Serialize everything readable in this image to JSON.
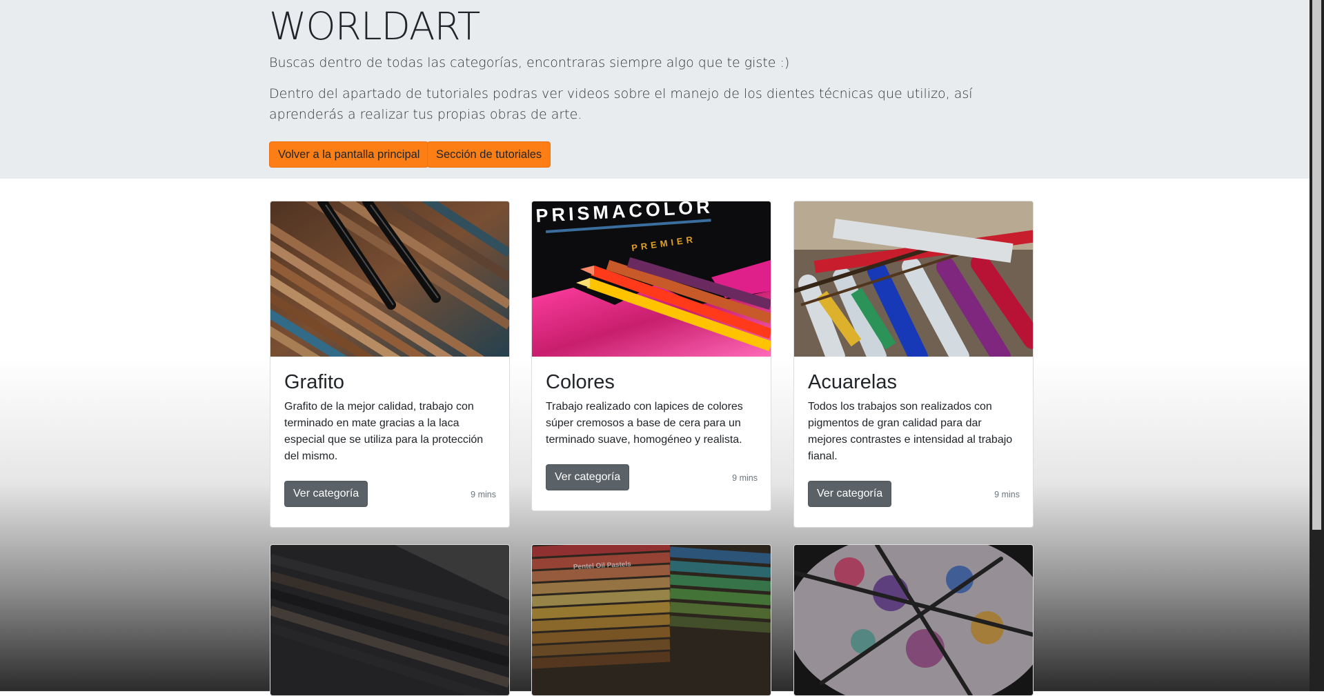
{
  "header": {
    "title": "WORLDART",
    "lead1": "Buscas dentro de todas las categorías, encontraras siempre algo que te giste :)",
    "lead2": "Dentro del apartado de tutoriales podras ver videos sobre el manejo de los dientes técnicas que utilizo, así aprenderás a realizar tus propias obras de arte.",
    "btn_home": "Volver a la pantalla principal",
    "btn_tutorials": "Sección de tutoriales"
  },
  "cards": [
    {
      "title": "Grafito",
      "text": "Grafito de la mejor calidad, trabajo con terminado en mate gracias a la laca especial que se utiliza para la protección del mismo.",
      "button": "Ver categoría",
      "time": "9 mins"
    },
    {
      "title": "Colores",
      "text": "Trabajo realizado con lapices de colores súper cremosos a base de cera para un terminado suave, homogéneo y realista.",
      "button": "Ver categoría",
      "time": "9 mins"
    },
    {
      "title": "Acuarelas",
      "text": "Todos los trabajos son realizados con pigmentos de gran calidad para dar mejores contrastes e intensidad al trabajo fianal.",
      "button": "Ver categoría",
      "time": "9 mins"
    }
  ],
  "images": {
    "prismacolor_brand": "PRISMACOLOR",
    "prismacolor_sub": "PREMIER",
    "pentel_label": "Pentel Oil Pastels"
  },
  "colors": {
    "accent": "#fd7e14",
    "jumbotron_bg": "#e9ecef",
    "card_button": "#5a6268"
  }
}
